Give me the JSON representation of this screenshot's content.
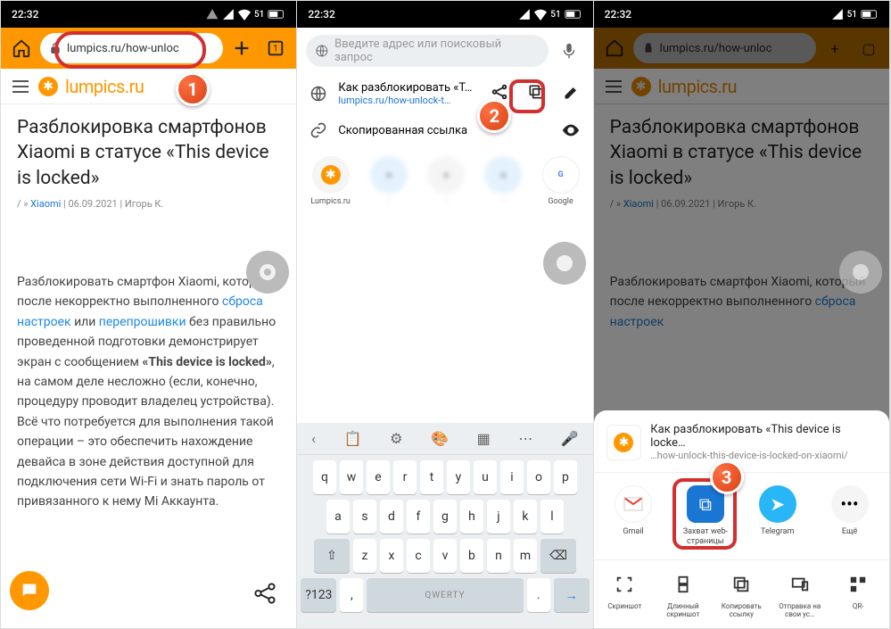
{
  "status": {
    "time": "22:32",
    "battery": "51"
  },
  "col1": {
    "url": "lumpics.ru/how-unloc",
    "logo": "lumpics.ru",
    "title": "Разблокировка смартфонов Xiaomi в статусе «This device is locked»",
    "meta_cat": "Xiaomi",
    "meta_date": "06.09.2021",
    "meta_author": "Игорь К.",
    "para_pre": "Разблокировать смартфон Xiaomi, который после некорректно выполненного ",
    "para_l1": "сброса настроек",
    "para_mid1": " или ",
    "para_l2": "перепрошивки",
    "para_mid2": " без правильно проведенной подготовки демонстрирует экран с сообщением ",
    "para_b": "«This device is locked»",
    "para_post": ", на самом деле несложно (если, конечно, процедуру проводит владелец устройства). Всё что потребуется для выполнения такой операции – это обеспечить нахождение девайса в зоне действия доступной для подключения сети Wi-Fi и знать пароль от привязанного к нему Mi Аккаунта."
  },
  "col2": {
    "placeholder": "Введите адрес или поисковый запрос",
    "page_title": "Как разблокировать «T…",
    "page_url": "lumpics.ru/how-unlock-t…",
    "copied": "Скопированная ссылка",
    "tiles": [
      "Lumpics.ru",
      "",
      "",
      "",
      "Google"
    ],
    "kbd_rows": [
      [
        "q",
        "w",
        "e",
        "r",
        "t",
        "y",
        "u",
        "i",
        "o",
        "p"
      ],
      [
        "a",
        "s",
        "d",
        "f",
        "g",
        "h",
        "j",
        "k",
        "l"
      ],
      [
        "z",
        "x",
        "c",
        "v",
        "b",
        "n",
        "m"
      ]
    ],
    "kbd_sym": "?123",
    "kbd_space": "QWERTY",
    "kbd_go": "→"
  },
  "col3": {
    "sheet_title": "Как разблокировать «This device is locke…",
    "sheet_url": "…how-unlock-this-device-is-locked-on-xiaomi/",
    "apps": [
      {
        "name": "Gmail",
        "key": "gmail"
      },
      {
        "name": "Захват web-страницы",
        "key": "capture"
      },
      {
        "name": "Telegram",
        "key": "telegram"
      },
      {
        "name": "Ещё",
        "key": "more"
      }
    ],
    "acts": [
      {
        "name": "Скриншот",
        "key": "shot"
      },
      {
        "name": "Длинный скриншот",
        "key": "long"
      },
      {
        "name": "Копировать ссылку",
        "key": "copy"
      },
      {
        "name": "Отправка на свои ус…",
        "key": "send"
      },
      {
        "name": "QR-",
        "key": "qr"
      }
    ]
  }
}
